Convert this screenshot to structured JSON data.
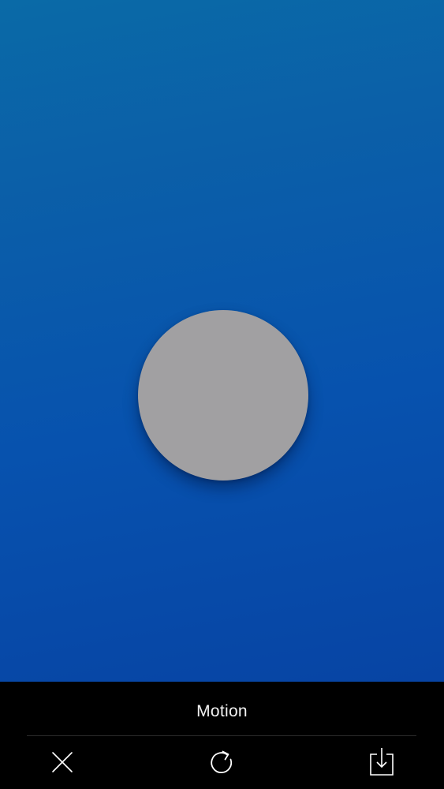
{
  "canvas": {
    "background_top": "#0a6aa7",
    "background_bottom": "#0744a4",
    "circle_color": "#a1a0a2"
  },
  "toolbar": {
    "mode_title": "Motion",
    "close_icon": "close-icon",
    "refresh_icon": "refresh-icon",
    "save_icon": "save-download-icon",
    "icon_color": "#ffffff"
  }
}
